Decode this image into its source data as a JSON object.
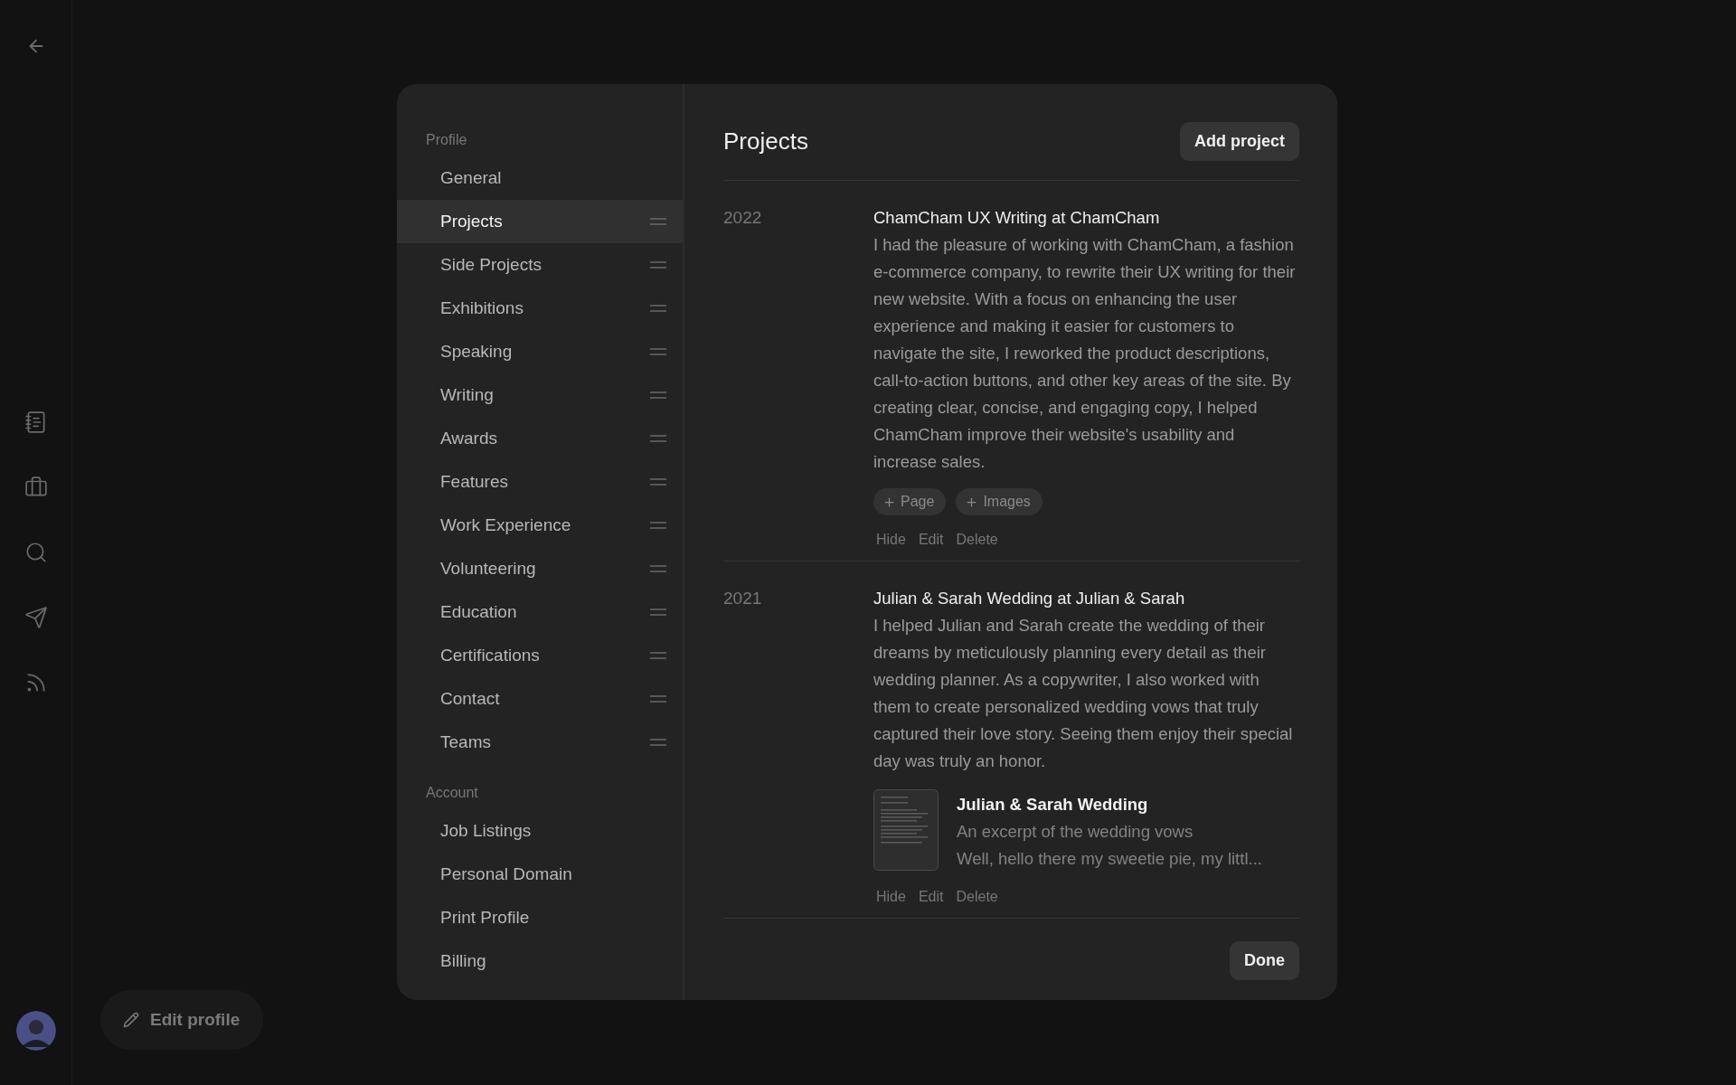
{
  "sidebar_sections": [
    {
      "title": "Profile",
      "items": [
        {
          "label": "General",
          "selected": false,
          "draggable": false
        },
        {
          "label": "Projects",
          "selected": true,
          "draggable": true
        },
        {
          "label": "Side Projects",
          "selected": false,
          "draggable": true
        },
        {
          "label": "Exhibitions",
          "selected": false,
          "draggable": true
        },
        {
          "label": "Speaking",
          "selected": false,
          "draggable": true
        },
        {
          "label": "Writing",
          "selected": false,
          "draggable": true
        },
        {
          "label": "Awards",
          "selected": false,
          "draggable": true
        },
        {
          "label": "Features",
          "selected": false,
          "draggable": true
        },
        {
          "label": "Work Experience",
          "selected": false,
          "draggable": true
        },
        {
          "label": "Volunteering",
          "selected": false,
          "draggable": true
        },
        {
          "label": "Education",
          "selected": false,
          "draggable": true
        },
        {
          "label": "Certifications",
          "selected": false,
          "draggable": true
        },
        {
          "label": "Contact",
          "selected": false,
          "draggable": true
        },
        {
          "label": "Teams",
          "selected": false,
          "draggable": true
        }
      ]
    },
    {
      "title": "Account",
      "items": [
        {
          "label": "Job Listings",
          "selected": false,
          "draggable": false
        },
        {
          "label": "Personal Domain",
          "selected": false,
          "draggable": false
        },
        {
          "label": "Print Profile",
          "selected": false,
          "draggable": false
        },
        {
          "label": "Billing",
          "selected": false,
          "draggable": false
        }
      ]
    }
  ],
  "panel": {
    "title": "Projects",
    "add_button": "Add project",
    "done_button": "Done",
    "projects": [
      {
        "year": "2022",
        "title": "ChamCham UX Writing at ChamCham",
        "description": "I had the pleasure of working with ChamCham, a fashion e-commerce company, to rewrite their UX writing for their new website. With a focus on enhancing the user experience and making it easier for customers to navigate the site, I reworked the product descriptions, call-to-action buttons, and other key areas of the site. By creating clear, concise, and engaging copy, I helped ChamCham improve their website's usability and increase sales.",
        "add_buttons": [
          "Page",
          "Images"
        ],
        "actions": [
          "Hide",
          "Edit",
          "Delete"
        ]
      },
      {
        "year": "2021",
        "title": "Julian & Sarah Wedding at Julian & Sarah",
        "description": "I helped Julian and Sarah create the wedding of their dreams by meticulously planning every detail as their wedding planner. As a copywriter, I also worked with them to create personalized wedding vows that truly captured their love story. Seeing them enjoy their special day was truly an honor.",
        "document": {
          "title": "Julian & Sarah Wedding",
          "subtitle": "An excerpt of the wedding vows",
          "excerpt": "Well, hello there my sweetie pie, my littl..."
        },
        "actions": [
          "Hide",
          "Edit",
          "Delete"
        ]
      }
    ]
  },
  "edit_profile_button": "Edit profile"
}
